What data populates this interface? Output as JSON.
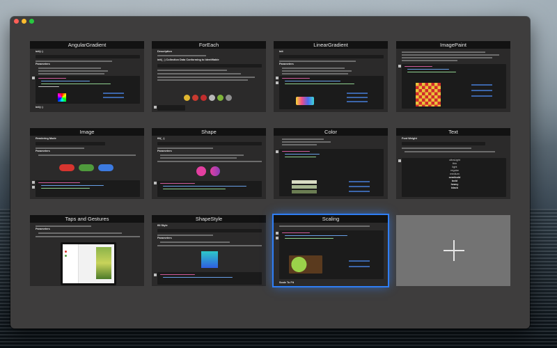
{
  "window": {
    "controls": [
      "close",
      "minimize",
      "zoom"
    ]
  },
  "cards": [
    {
      "title": "AngularGradient",
      "heading": "init(::)",
      "params_label": "Parameters",
      "footer": "init(::)"
    },
    {
      "title": "ForEach",
      "heading": "Description",
      "subheading": "init(_:) Collection Data Conforming to Identifiable"
    },
    {
      "title": "LinearGradient",
      "heading": "init",
      "params_label": "Parameters"
    },
    {
      "title": "ImagePaint"
    },
    {
      "title": "Image",
      "heading": "Rendering Mode",
      "params_label": "Parameters"
    },
    {
      "title": "Shape",
      "heading": "fill(_:)",
      "params_label": "Parameters"
    },
    {
      "title": "Color"
    },
    {
      "title": "Text",
      "heading": "Font Weight",
      "weights": [
        "ultraLight",
        "thin",
        "light",
        "regular",
        "medium",
        "semibold",
        "bold",
        "heavy",
        "black"
      ]
    },
    {
      "title": "Taps and Gestures",
      "params_label": "Parameters"
    },
    {
      "title": "ShapeStyle",
      "heading": "fill Style",
      "params_label": "Parameters"
    },
    {
      "title": "Scaling",
      "footer": "Scale To Fit",
      "selected": true
    },
    {
      "title": "",
      "icon": "plus-icon",
      "add_card": true
    }
  ]
}
